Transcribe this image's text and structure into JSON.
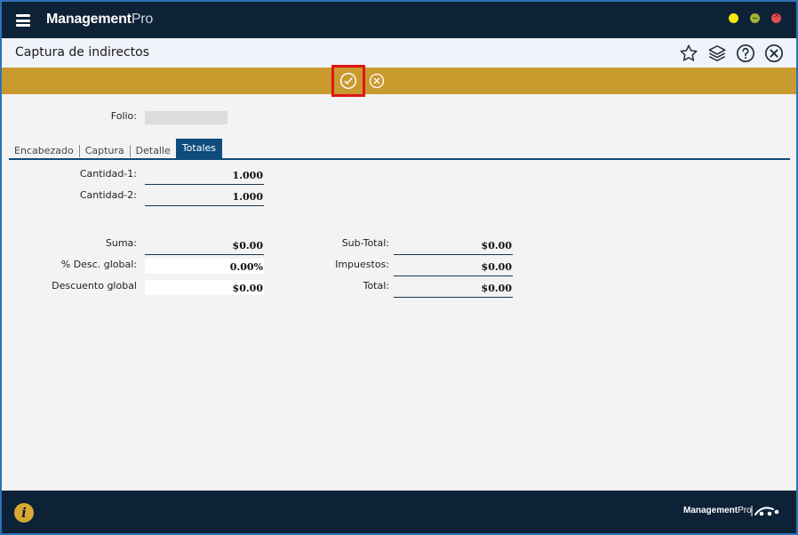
{
  "app": {
    "brand_bold": "Management",
    "brand_light": "Pro"
  },
  "header": {
    "title": "Captura de indirectos"
  },
  "form": {
    "folio_label": "Folio:",
    "folio_value": ""
  },
  "tabs": [
    {
      "label": "Encabezado",
      "active": false
    },
    {
      "label": "Captura",
      "active": false
    },
    {
      "label": "Detalle",
      "active": false
    },
    {
      "label": "Totales",
      "active": true
    }
  ],
  "totales": {
    "cantidad1_label": "Cantidad-1:",
    "cantidad1_value": "1.000",
    "cantidad2_label": "Cantidad-2:",
    "cantidad2_value": "1.000",
    "suma_label": "Suma:",
    "suma_value": "$0.00",
    "desc_pct_label": "% Desc. global:",
    "desc_pct_value": "0.00%",
    "desc_global_label": "Descuento global",
    "desc_global_value": "$0.00",
    "subtotal_label": "Sub-Total:",
    "subtotal_value": "$0.00",
    "impuestos_label": "Impuestos:",
    "impuestos_value": "$0.00",
    "total_label": "Total:",
    "total_value": "$0.00"
  },
  "footer": {
    "info": "i",
    "brand_bold": "Management",
    "brand_light": "Pro"
  },
  "colors": {
    "titlebar": "#0d2236",
    "actionbar": "#c99a2e",
    "tab_active": "#0e4c7c",
    "highlight": "#e01515"
  },
  "icons": [
    "menu-icon",
    "star-icon",
    "layers-icon",
    "help-icon",
    "close-circle-icon",
    "check-circle-icon",
    "cancel-circle-icon",
    "info-icon"
  ]
}
